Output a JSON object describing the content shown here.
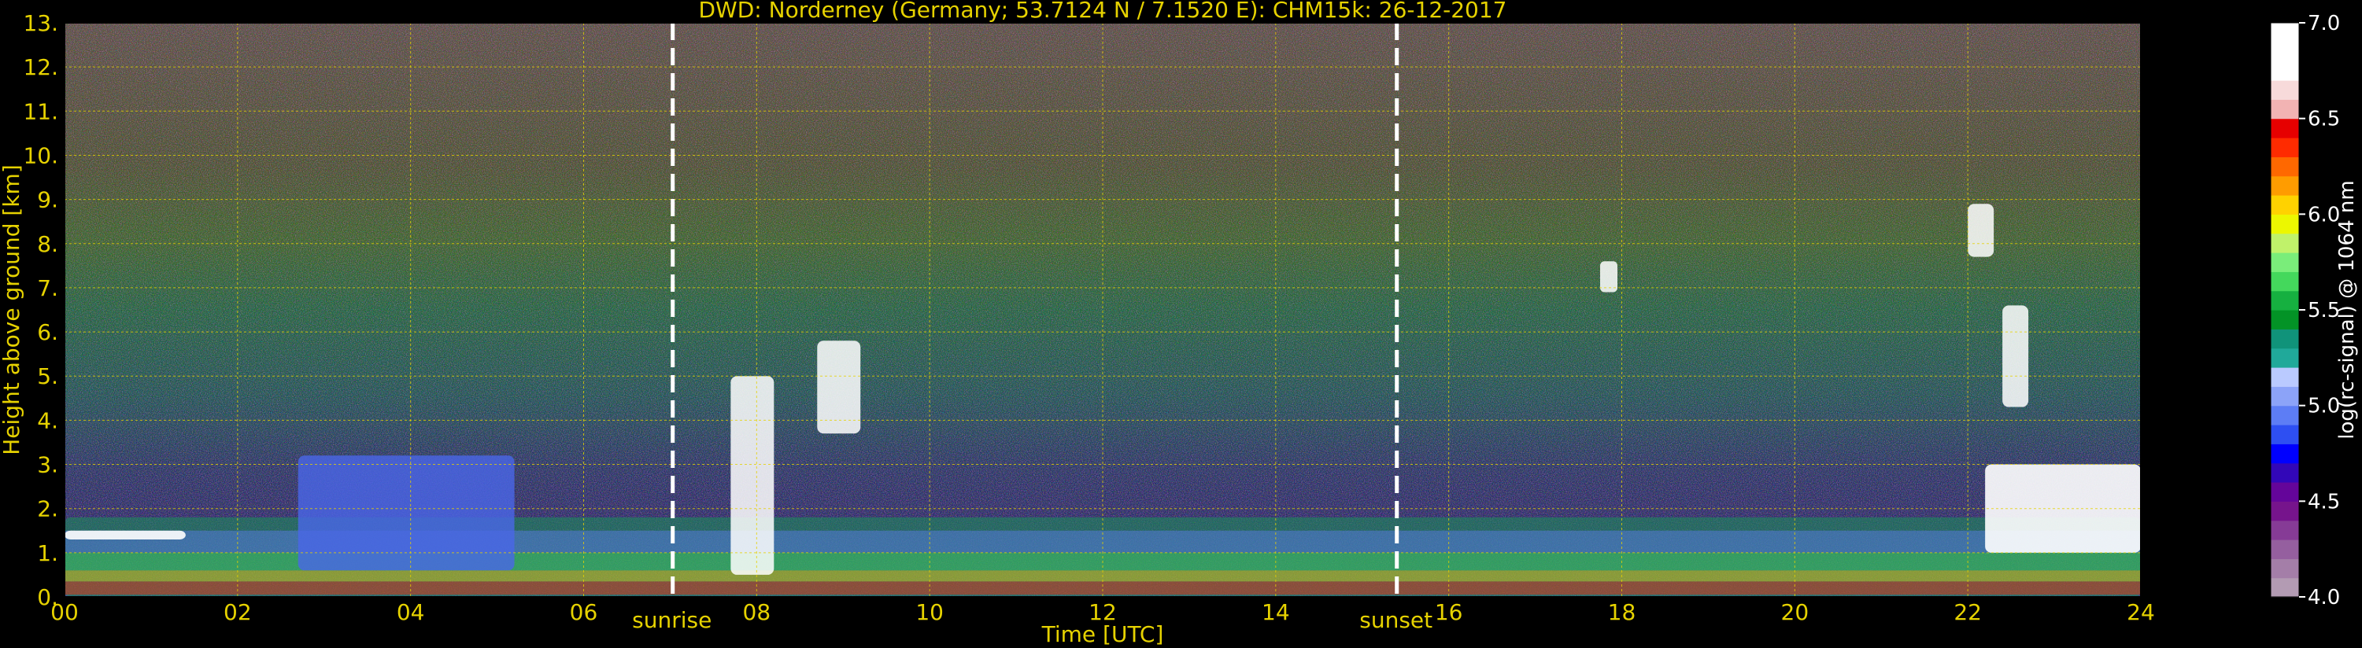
{
  "chart_data": {
    "type": "heatmap",
    "title": "DWD: Norderney (Germany; 53.7124 N / 7.1520 E):    CHM15k: 26-12-2017",
    "xlabel": "Time [UTC]",
    "ylabel": "Height above ground [km]",
    "xlim": [
      0,
      24
    ],
    "ylim": [
      0,
      13
    ],
    "x_ticks": [
      "00",
      "02",
      "04",
      "06",
      "08",
      "10",
      "12",
      "14",
      "16",
      "18",
      "20",
      "22",
      "24"
    ],
    "y_ticks": [
      "0.",
      "1.",
      "2.",
      "3.",
      "4.",
      "5.",
      "6.",
      "7.",
      "8.",
      "9.",
      "10.",
      "11.",
      "12.",
      "13."
    ],
    "grid": true,
    "colorbar": {
      "label": "log(rc-signal) @ 1064 nm",
      "range": [
        4.0,
        7.0
      ],
      "ticks": [
        "4.0",
        "4.5",
        "5.0",
        "5.5",
        "6.0",
        "6.5",
        "7.0"
      ],
      "colors": [
        "#b39bb3",
        "#a47ea8",
        "#955f9f",
        "#863b96",
        "#76148c",
        "#64059a",
        "#3207b8",
        "#0000ff",
        "#2e4ff2",
        "#5d7df5",
        "#8ca3f8",
        "#bacaff",
        "#20a99a",
        "#10937a",
        "#039326",
        "#16b040",
        "#44d85c",
        "#7aed7a",
        "#c0f26a",
        "#ecf700",
        "#ffd200",
        "#ff9c00",
        "#ff6800",
        "#ff2b00",
        "#e60000",
        "#f2b3b3",
        "#f7dada",
        "#ffffff",
        "#ffffff",
        "#ffffff"
      ]
    },
    "annotations": [
      {
        "text": "sunrise",
        "x_hours": 7.03
      },
      {
        "text": "sunset",
        "x_hours": 15.4
      }
    ],
    "features": [
      {
        "kind": "boundary_layer_aerosol",
        "x_range": [
          0,
          24
        ],
        "height_km": [
          0.0,
          1.8
        ]
      },
      {
        "kind": "low_cloud_top",
        "x_range": [
          0.0,
          1.4
        ],
        "height_km": [
          1.3,
          1.5
        ]
      },
      {
        "kind": "mid_cloud",
        "x_range": [
          2.7,
          5.2
        ],
        "height_km": [
          0.6,
          3.2
        ]
      },
      {
        "kind": "high_cloud",
        "x_range": [
          7.7,
          8.2
        ],
        "height_km": [
          0.5,
          5.0
        ]
      },
      {
        "kind": "high_cloud",
        "x_range": [
          8.7,
          9.2
        ],
        "height_km": [
          3.7,
          5.8
        ]
      },
      {
        "kind": "high_cloud",
        "x_range": [
          17.75,
          17.95
        ],
        "height_km": [
          6.9,
          7.6
        ]
      },
      {
        "kind": "high_cloud",
        "x_range": [
          22.0,
          22.3
        ],
        "height_km": [
          7.7,
          8.9
        ]
      },
      {
        "kind": "high_cloud",
        "x_range": [
          22.4,
          22.7
        ],
        "height_km": [
          4.3,
          6.6
        ]
      },
      {
        "kind": "low_cloud",
        "x_range": [
          22.2,
          24
        ],
        "height_km": [
          1.0,
          3.0
        ]
      }
    ]
  }
}
